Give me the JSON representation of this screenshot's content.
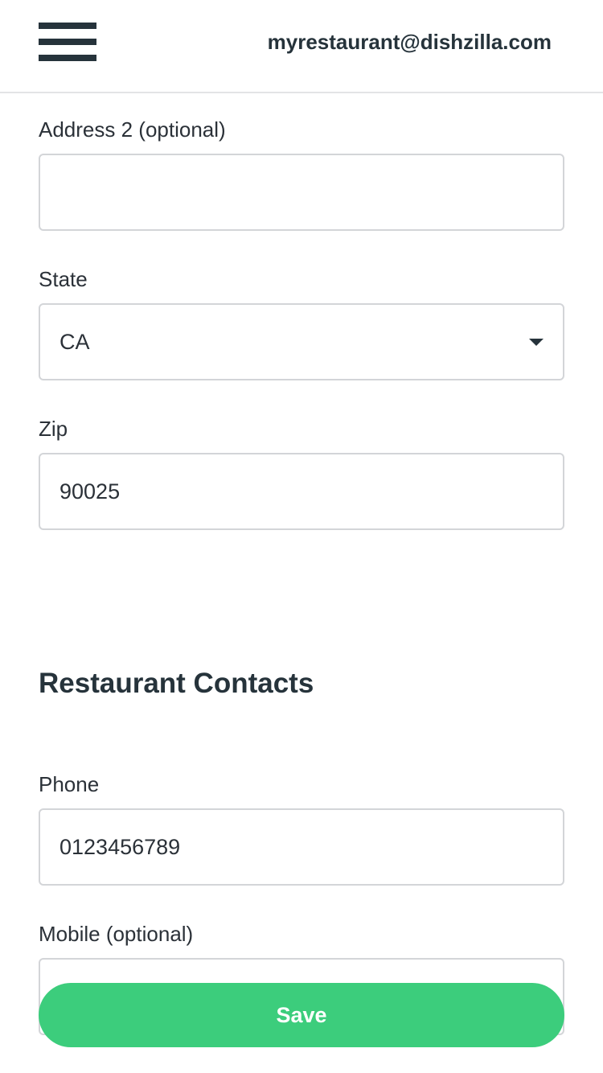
{
  "header": {
    "menu_icon": "hamburger-menu-icon",
    "account_email": "myrestaurant@dishzilla.com"
  },
  "address2": {
    "label": "Address 2 (optional)",
    "value": ""
  },
  "state": {
    "label": "State",
    "value": "CA",
    "icon": "caret-down-icon"
  },
  "zip": {
    "label": "Zip",
    "value": "90025"
  },
  "contacts": {
    "title": "Restaurant Contacts",
    "phone": {
      "label": "Phone",
      "value": "0123456789"
    },
    "mobile": {
      "label": "Mobile (optional)",
      "value": ""
    }
  },
  "actions": {
    "save_label": "Save"
  },
  "colors": {
    "accent": "#3ccd7c",
    "text": "#2b3138",
    "border": "#d3d5d8"
  }
}
